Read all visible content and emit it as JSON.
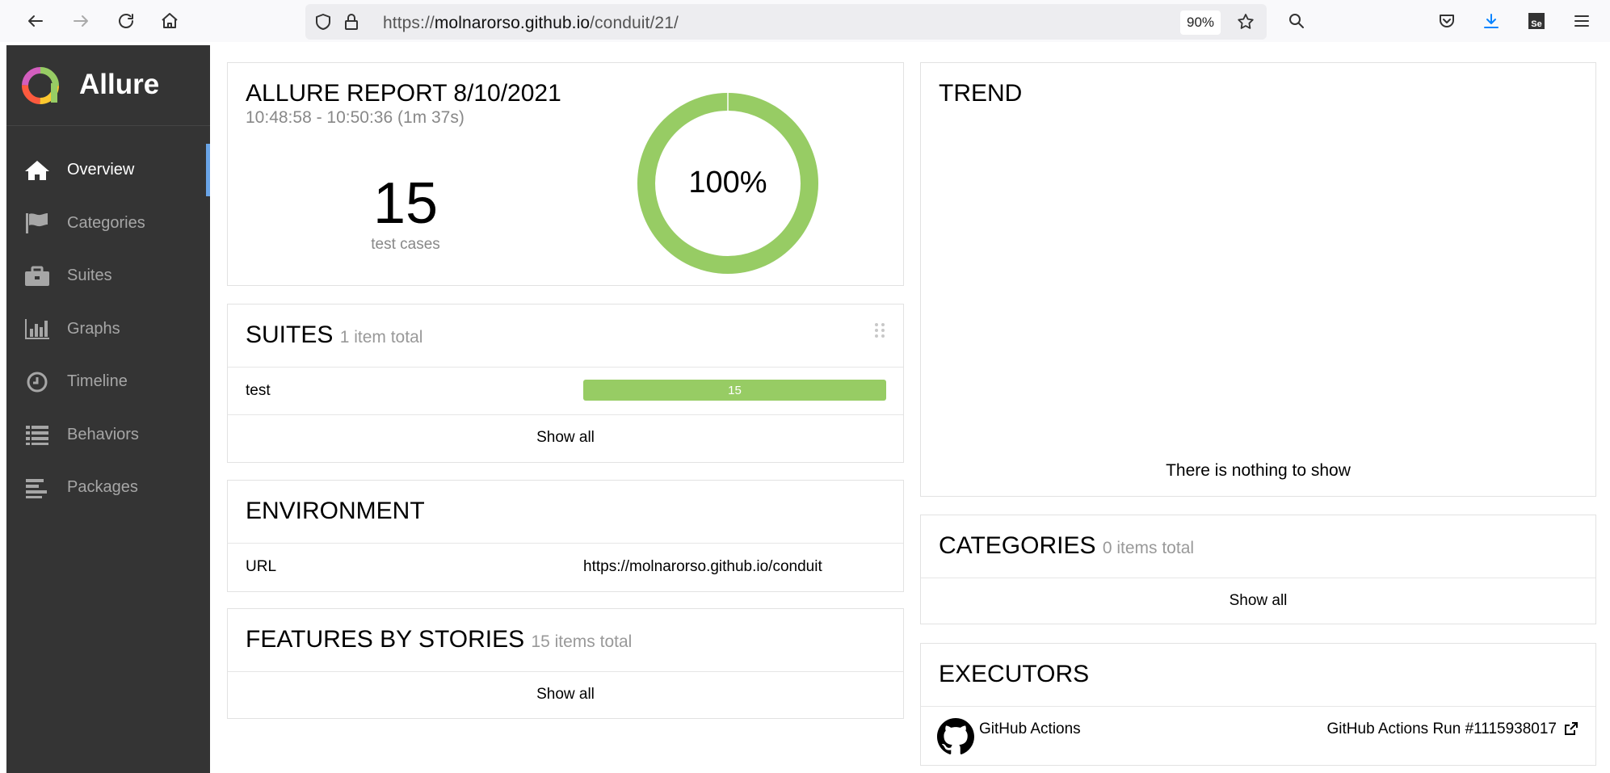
{
  "browser": {
    "url_prefix": "https://",
    "url_host": "molnarorso.github.io",
    "url_path": "/conduit/21/",
    "zoom": "90%"
  },
  "sidebar": {
    "brand": "Allure",
    "items": [
      {
        "label": "Overview",
        "icon": "home-icon",
        "active": true
      },
      {
        "label": "Categories",
        "icon": "flag-icon",
        "active": false
      },
      {
        "label": "Suites",
        "icon": "briefcase-icon",
        "active": false
      },
      {
        "label": "Graphs",
        "icon": "bar-chart-icon",
        "active": false
      },
      {
        "label": "Timeline",
        "icon": "clock-icon",
        "active": false
      },
      {
        "label": "Behaviors",
        "icon": "list-icon",
        "active": false
      },
      {
        "label": "Packages",
        "icon": "align-left-icon",
        "active": false
      }
    ]
  },
  "summary": {
    "title": "ALLURE REPORT 8/10/2021",
    "time_range": "10:48:58 - 10:50:36 (1m 37s)",
    "test_count": "15",
    "test_count_label": "test cases",
    "pass_percent_label": "100%",
    "pass_fraction": 1.0,
    "passed_color": "#97cc64"
  },
  "suites": {
    "title": "SUITES",
    "subtitle": "1 item total",
    "rows": [
      {
        "name": "test",
        "passed": "15"
      }
    ],
    "show_all": "Show all"
  },
  "environment": {
    "title": "ENVIRONMENT",
    "rows": [
      {
        "key": "URL",
        "value": "https://molnarorso.github.io/conduit"
      }
    ]
  },
  "features": {
    "title": "FEATURES BY STORIES",
    "subtitle": "15 items total",
    "show_all": "Show all"
  },
  "trend": {
    "title": "TREND",
    "empty": "There is nothing to show"
  },
  "categories": {
    "title": "CATEGORIES",
    "subtitle": "0 items total",
    "show_all": "Show all"
  },
  "executors": {
    "title": "EXECUTORS",
    "name": "GitHub Actions",
    "run": "GitHub Actions Run #1115938017"
  }
}
